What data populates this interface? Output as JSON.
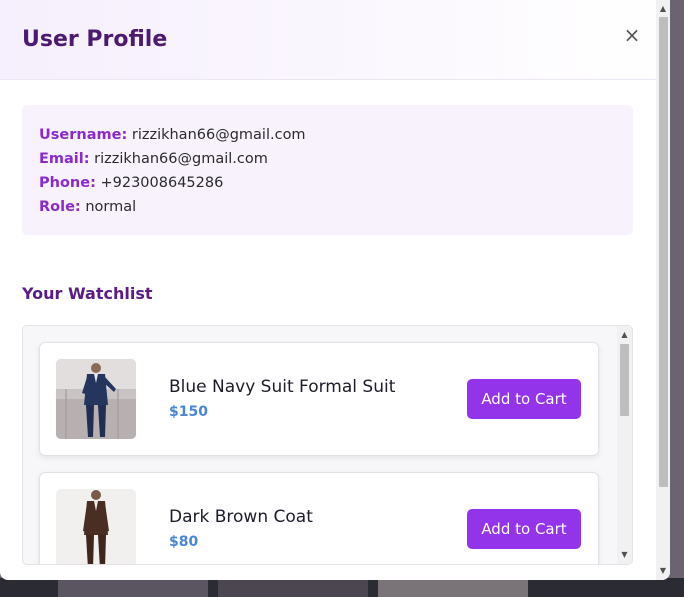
{
  "modal": {
    "title": "User Profile",
    "close_symbol": "×"
  },
  "profile": {
    "username_label": "Username:",
    "username": "rizzikhan66@gmail.com",
    "email_label": "Email:",
    "email": "rizzikhan66@gmail.com",
    "phone_label": "Phone:",
    "phone": "+923008645286",
    "role_label": "Role:",
    "role": "normal"
  },
  "watchlist": {
    "title": "Your Watchlist",
    "items": [
      {
        "name": "Blue Navy Suit Formal Suit",
        "price": "$150",
        "button_label": "Add to Cart",
        "thumb_icon": "navy-suit-photo"
      },
      {
        "name": "Dark Brown Coat",
        "price": "$80",
        "button_label": "Add to Cart",
        "thumb_icon": "brown-coat-photo"
      }
    ]
  },
  "colors": {
    "title": "#4d1a73",
    "label_accent": "#8a2bc9",
    "price": "#4a86d8",
    "button": "#9333ea"
  }
}
